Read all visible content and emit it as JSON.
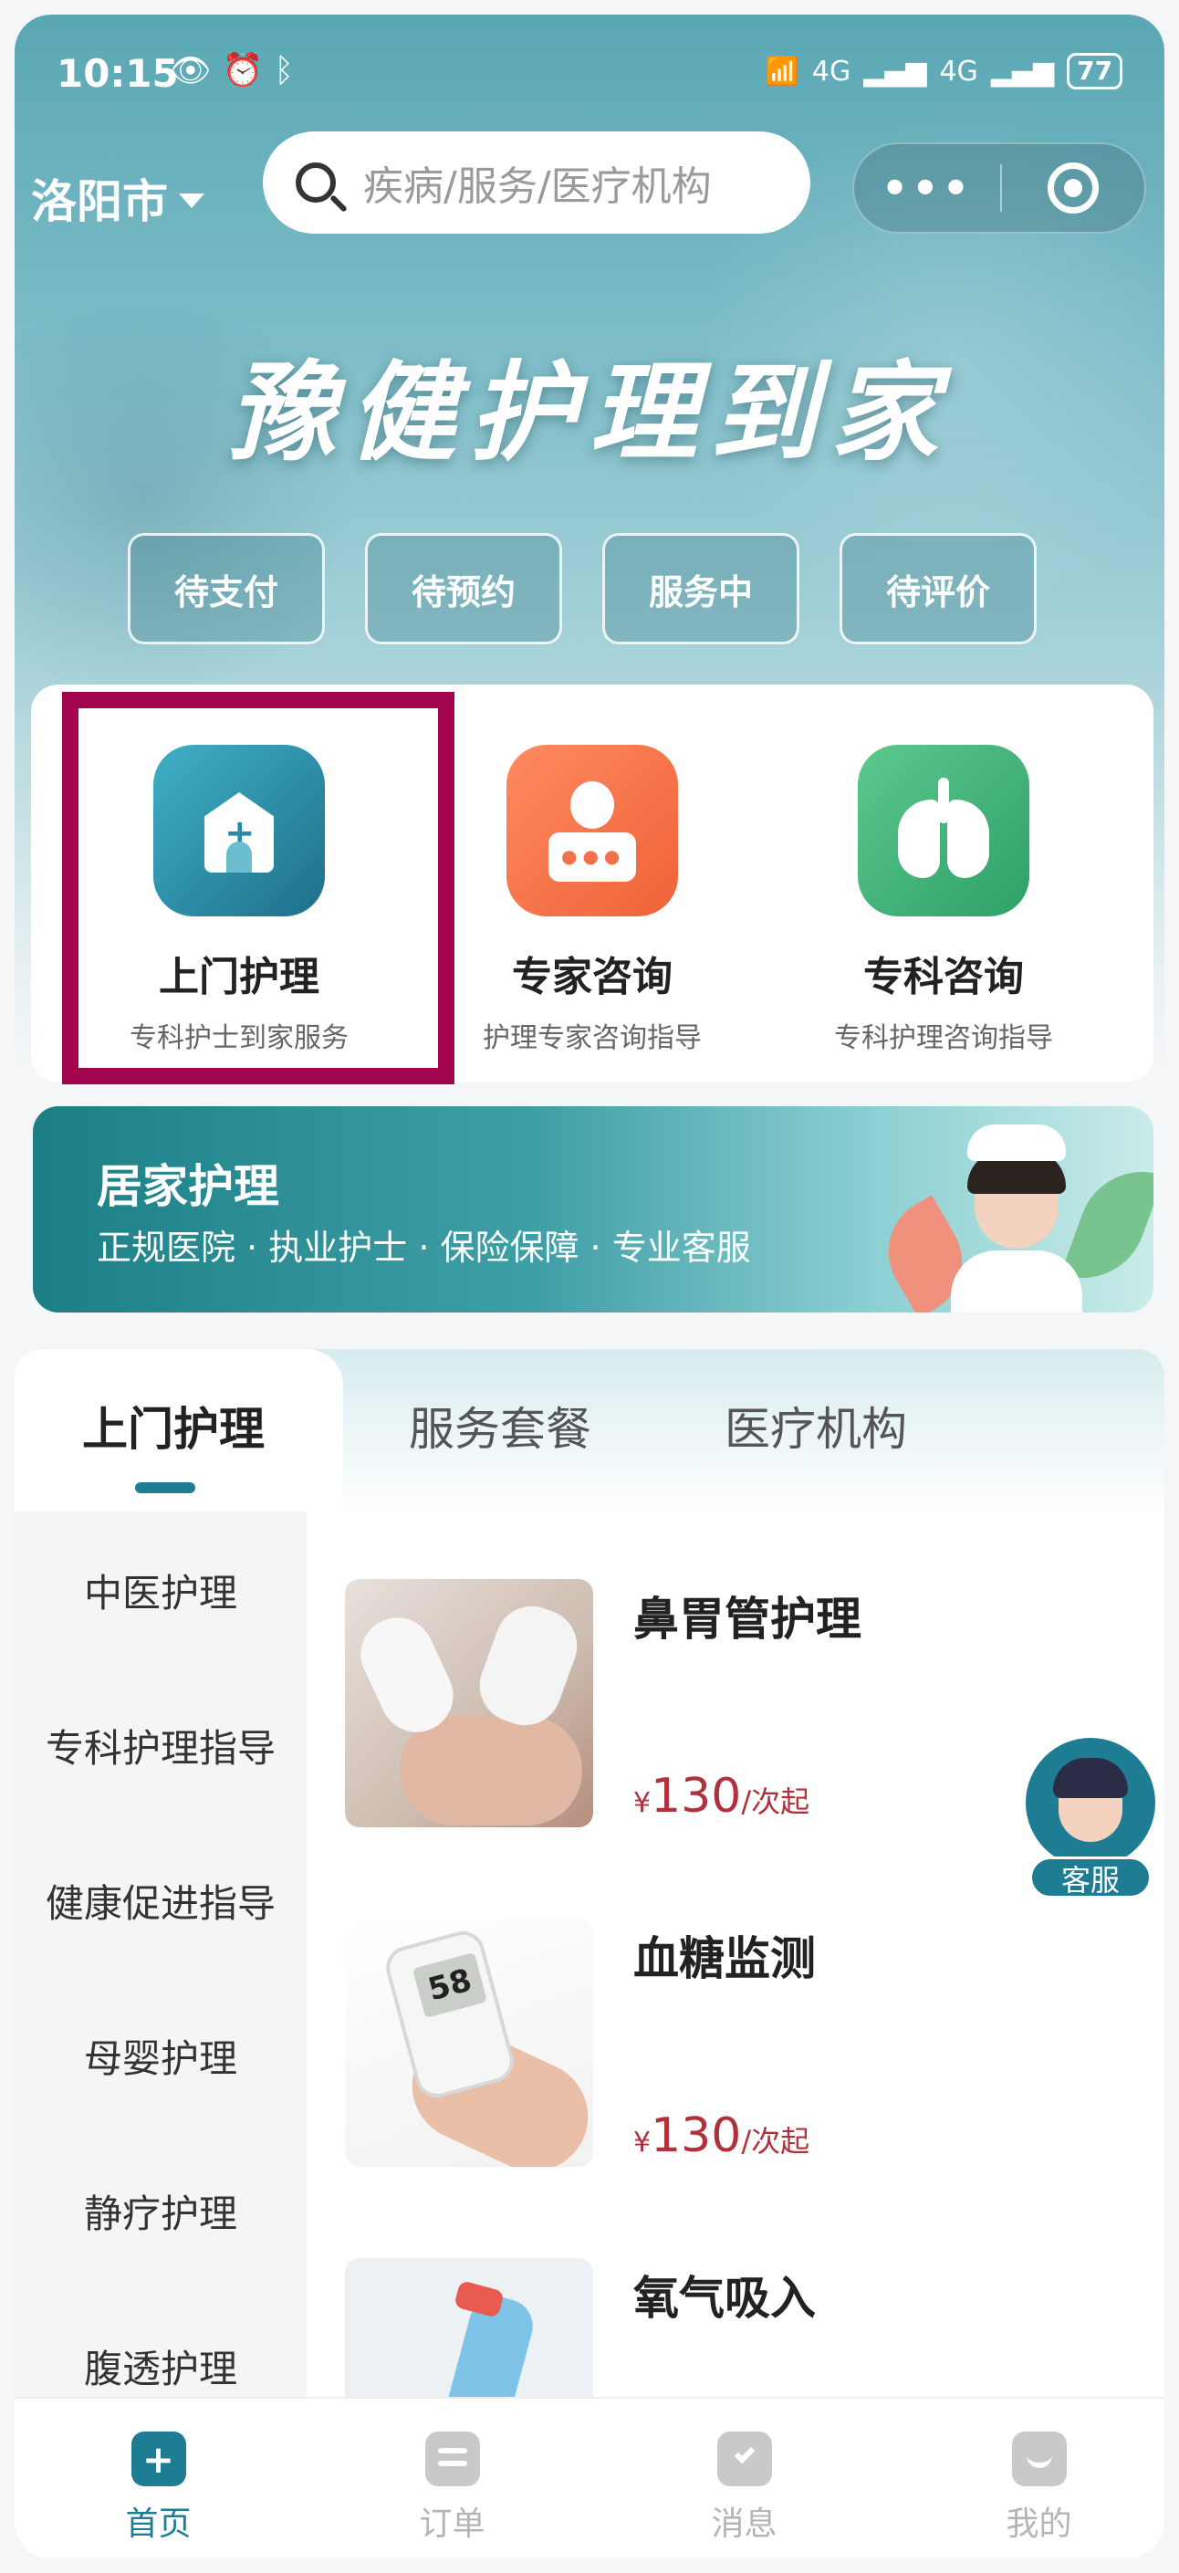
{
  "status_bar": {
    "time": "10:15",
    "left_icons": [
      "eye-icon",
      "alarm-icon",
      "bluetooth-icon"
    ],
    "network1": "4G",
    "network2": "4G",
    "battery": "77"
  },
  "header": {
    "city": "洛阳市",
    "search_placeholder": "疾病/服务/医疗机构",
    "capsule_more": "•••"
  },
  "banner": {
    "title": "豫健护理到家"
  },
  "order_status": [
    {
      "label": "待支付"
    },
    {
      "label": "待预约"
    },
    {
      "label": "服务中"
    },
    {
      "label": "待评价"
    }
  ],
  "services": [
    {
      "title": "上门护理",
      "subtitle": "专科护士到家服务",
      "icon": "home-care-icon",
      "color": "#2a8aa5"
    },
    {
      "title": "专家咨询",
      "subtitle": "护理专家咨询指导",
      "icon": "expert-icon",
      "color": "#f0714a"
    },
    {
      "title": "专科咨询",
      "subtitle": "专科护理咨询指导",
      "icon": "lungs-icon",
      "color": "#3bb27a"
    }
  ],
  "home_care_banner": {
    "title": "居家护理",
    "subtitle": "正规医院 · 执业护士 · 保险保障 · 专业客服"
  },
  "tabs": [
    {
      "label": "上门护理",
      "active": true
    },
    {
      "label": "服务套餐",
      "active": false
    },
    {
      "label": "医疗机构",
      "active": false
    }
  ],
  "categories": [
    {
      "label": "中医护理"
    },
    {
      "label": "专科护理指导"
    },
    {
      "label": "健康促进指导"
    },
    {
      "label": "母婴护理"
    },
    {
      "label": "静疗护理"
    },
    {
      "label": "腹透护理"
    }
  ],
  "products": [
    {
      "name": "鼻胃管护理",
      "currency": "¥",
      "price": "130",
      "unit": "/次起"
    },
    {
      "name": "血糖监测",
      "currency": "¥",
      "price": "130",
      "unit": "/次起",
      "meter_reading": "58"
    },
    {
      "name": "氧气吸入"
    }
  ],
  "customer_service": {
    "label": "客服"
  },
  "bottom_nav": [
    {
      "label": "首页",
      "active": true,
      "icon": "home-icon"
    },
    {
      "label": "订单",
      "active": false,
      "icon": "order-icon"
    },
    {
      "label": "消息",
      "active": false,
      "icon": "message-icon"
    },
    {
      "label": "我的",
      "active": false,
      "icon": "profile-icon"
    }
  ],
  "colors": {
    "accent": "#1f7d93",
    "highlight_border": "#a3064f",
    "price": "#b0313b"
  }
}
